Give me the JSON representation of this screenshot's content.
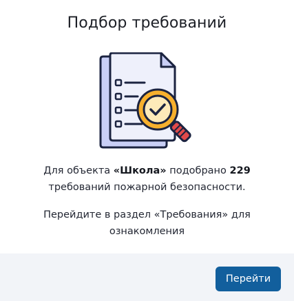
{
  "dialog": {
    "title": "Подбор требований",
    "message": {
      "prefix": "Для объекта ",
      "object_name": "«Школа»",
      "middle": " подобрано ",
      "count": "229",
      "suffix_line2": "требований пожарной безопасности."
    },
    "hint_line1": "Перейдите в раздел «Требования» для",
    "hint_line2": "ознакомления",
    "go_button_label": "Перейти"
  },
  "illustration": {
    "icon": "document-search-icon",
    "colors": {
      "outline": "#1b2340",
      "paper_back": "#c9cff6",
      "paper_front": "#eef0fb",
      "magnifier_rim": "#f7b02d",
      "magnifier_glass": "#fdeab9",
      "handle": "#e14a4a",
      "check": "#1b2340"
    }
  },
  "colors": {
    "accent": "#125f9d",
    "footer_bg": "#f2f4f8"
  }
}
